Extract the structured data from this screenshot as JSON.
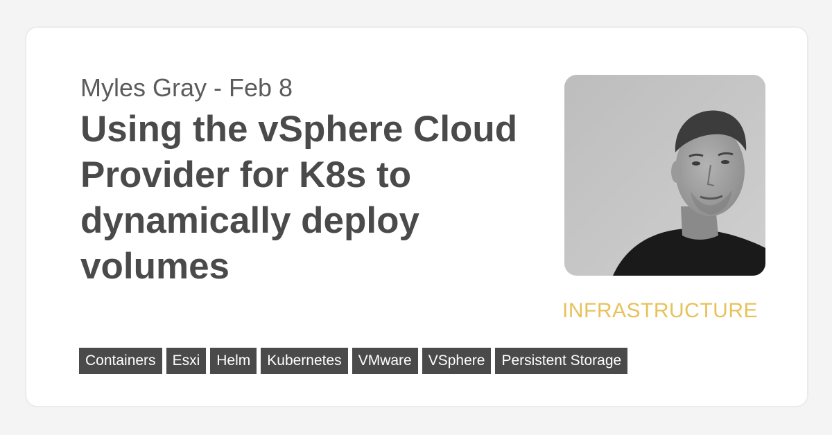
{
  "post": {
    "byline": "Myles Gray - Feb 8",
    "author": "Myles Gray",
    "date": "Feb 8",
    "title": "Using the vSphere Cloud Provider for K8s to dynamically deploy volumes",
    "category": "INFRASTRUCTURE",
    "tags": [
      "Containers",
      "Esxi",
      "Helm",
      "Kubernetes",
      "VMware",
      "VSphere",
      "Persistent Storage"
    ]
  },
  "colors": {
    "background": "#f4f4f4",
    "card": "#ffffff",
    "text": "#4a4a4a",
    "byline": "#5b5b5b",
    "category": "#e7c25b",
    "tag_bg": "#4a4a4a",
    "tag_text": "#ffffff"
  },
  "icons": {
    "author_photo": "author-photo"
  }
}
